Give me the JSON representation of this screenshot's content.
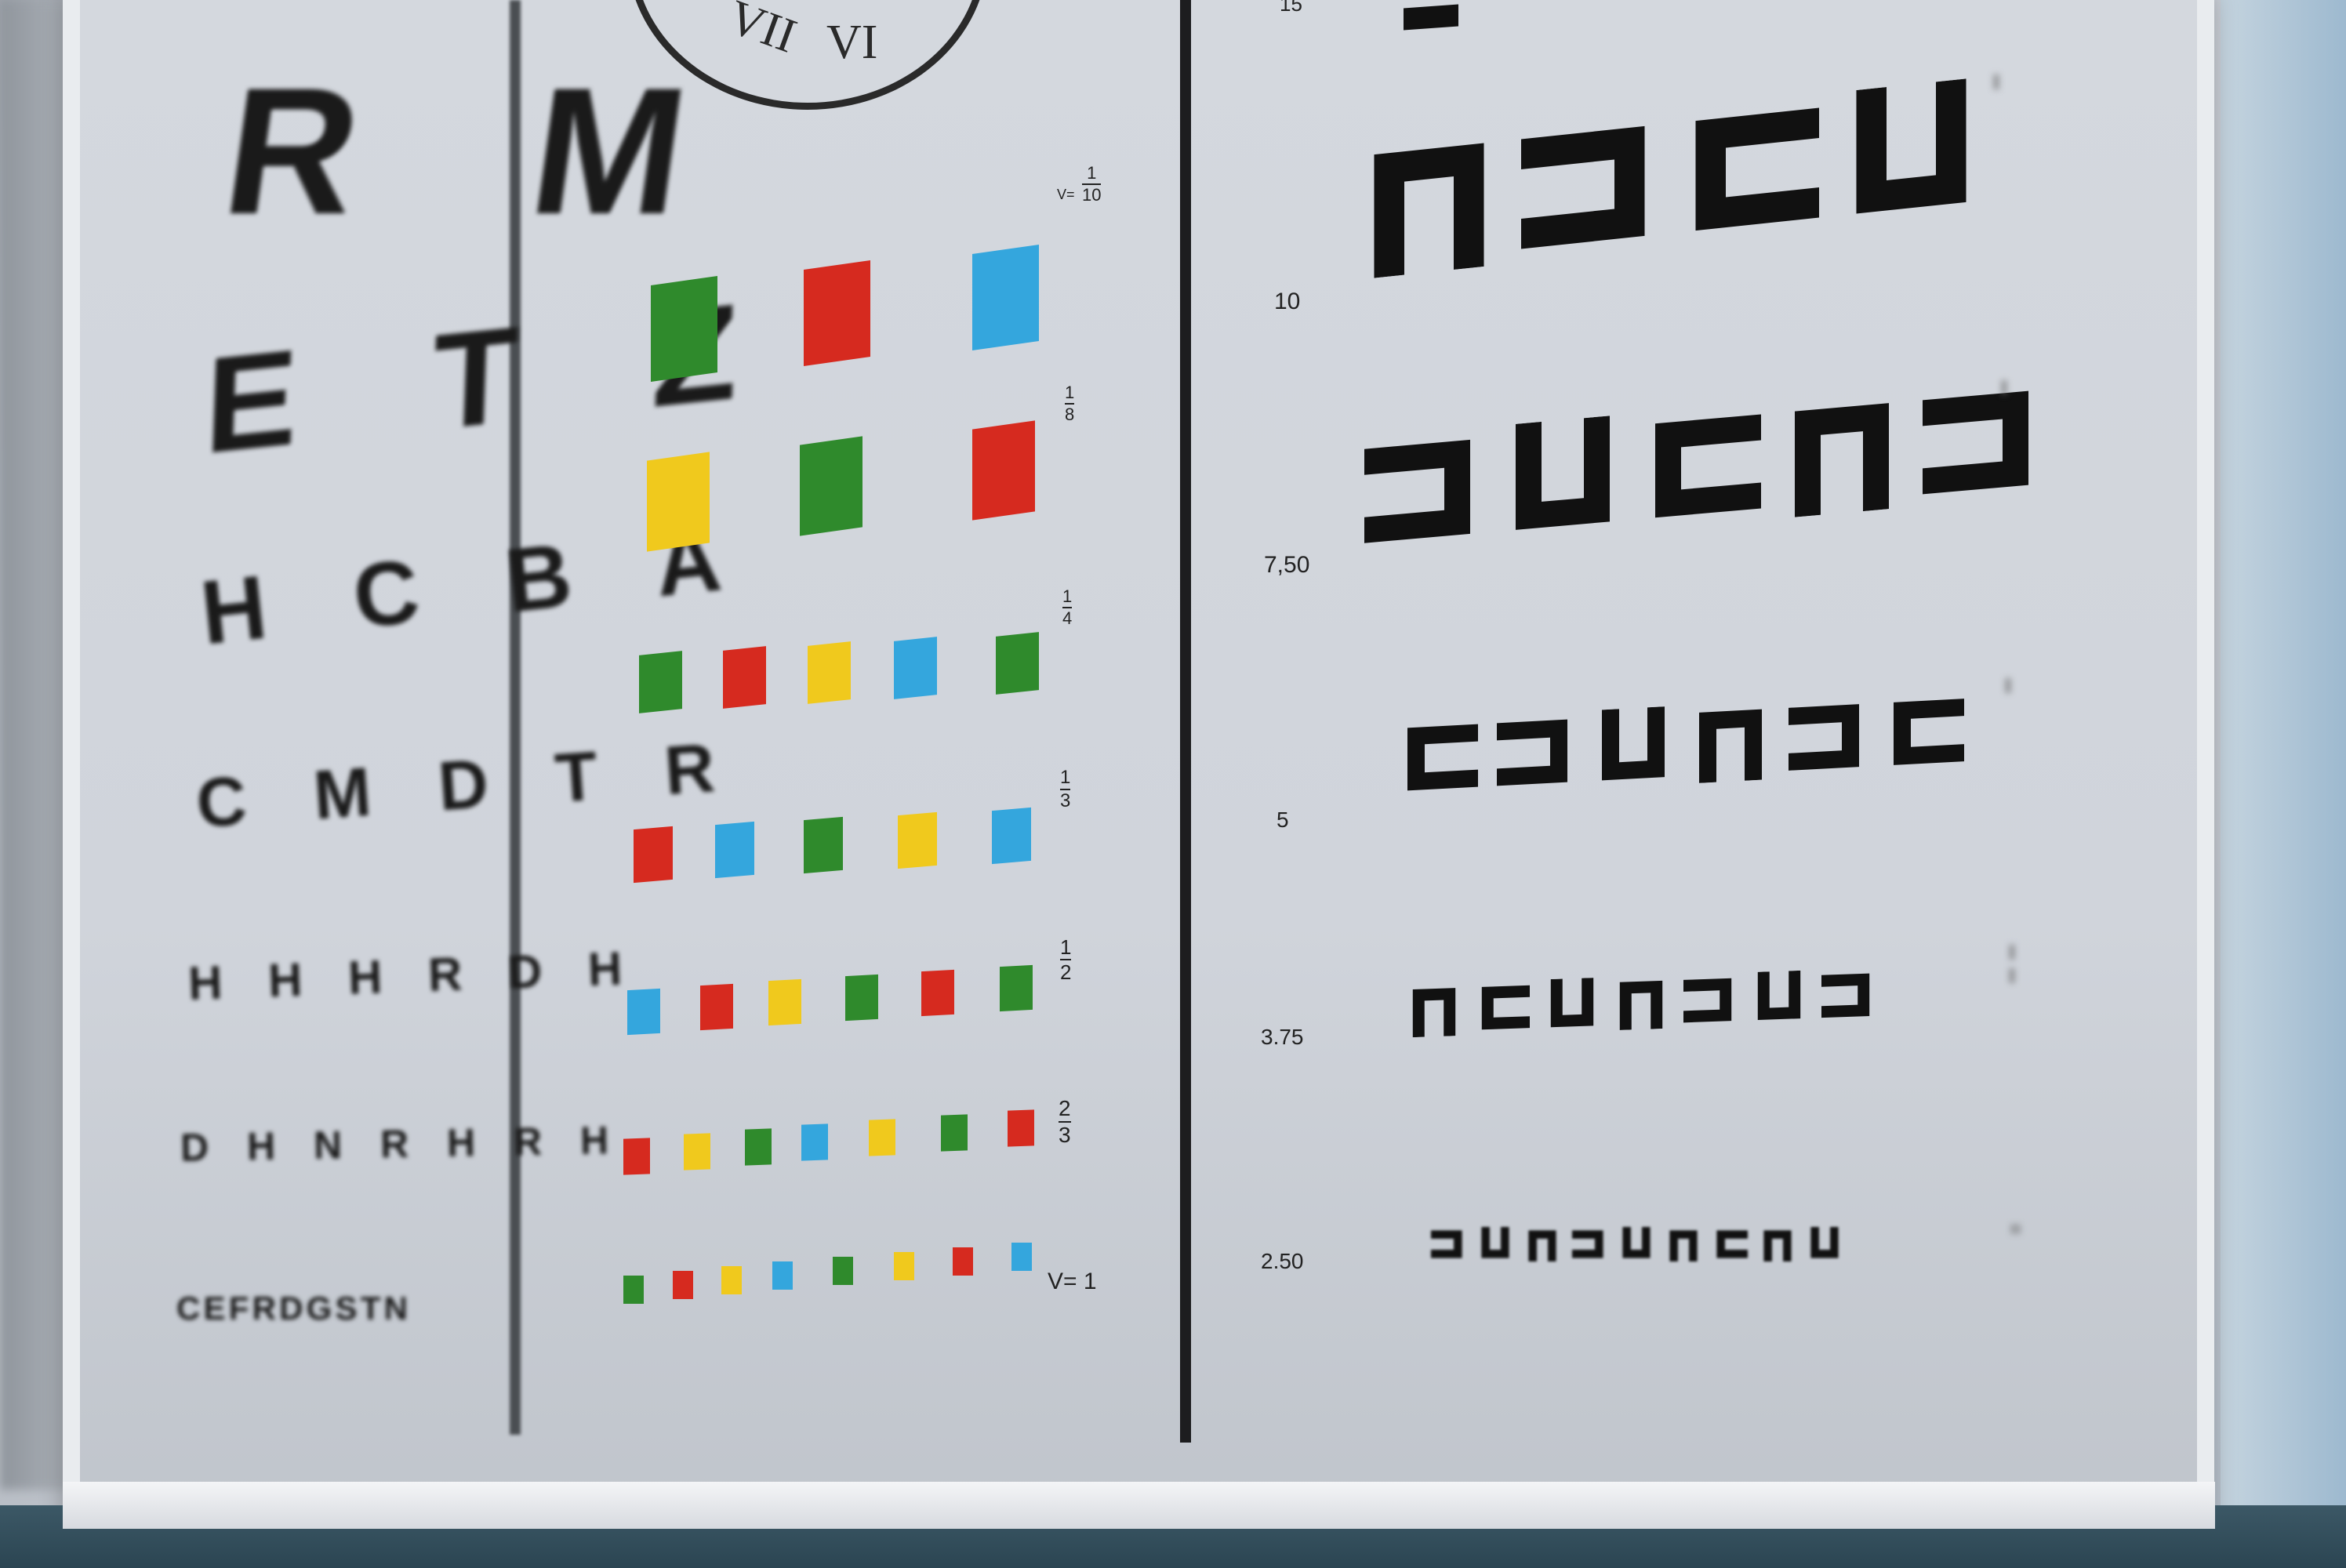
{
  "chart": {
    "left_column": {
      "rows": [
        {
          "letters": "R M"
        },
        {
          "letters": "E T Z"
        },
        {
          "letters": "H C B A"
        },
        {
          "letters": "C M D T R"
        },
        {
          "letters": "H H H R D H"
        },
        {
          "letters": "D H N R H R H"
        },
        {
          "letters": "CEFRDGSTN"
        }
      ]
    },
    "clock": {
      "numerals": [
        "VI",
        "VII"
      ]
    },
    "color_column": {
      "v_prefix": "V=",
      "fractions": [
        {
          "num": "1",
          "den": "10"
        },
        {
          "num": "1",
          "den": "8"
        },
        {
          "num": "1",
          "den": "4"
        },
        {
          "num": "1",
          "den": "3"
        },
        {
          "num": "1",
          "den": "2"
        },
        {
          "num": "2",
          "den": "3"
        }
      ],
      "last_label": "V= 1",
      "rows": [
        {
          "colors": [
            "green",
            "red",
            "blue"
          ]
        },
        {
          "colors": [
            "yellow",
            "green",
            "red"
          ]
        },
        {
          "colors": [
            "green",
            "red",
            "yellow",
            "blue",
            "green"
          ]
        },
        {
          "colors": [
            "red",
            "blue",
            "green",
            "yellow",
            "blue"
          ]
        },
        {
          "colors": [
            "blue",
            "red",
            "yellow",
            "green",
            "red",
            "green"
          ]
        },
        {
          "colors": [
            "red",
            "yellow",
            "green",
            "blue",
            "yellow",
            "green",
            "red"
          ]
        },
        {
          "colors": [
            "green",
            "red",
            "yellow",
            "blue",
            "green",
            "yellow",
            "red",
            "blue"
          ]
        }
      ],
      "palette": {
        "green": "#2f8a2c",
        "red": "#d62a1f",
        "blue": "#34a6dd",
        "yellow": "#f0c91d"
      }
    },
    "right_column": {
      "acuity_labels": [
        "15",
        "10",
        "7,50",
        "5",
        "3.75",
        "2.50"
      ],
      "rows": [
        {
          "symbols": [
            "partial"
          ]
        },
        {
          "symbols": [
            "n",
            "reverse-c",
            "c",
            "u"
          ]
        },
        {
          "symbols": [
            "reverse-c",
            "u",
            "c",
            "n",
            "reverse-c"
          ]
        },
        {
          "symbols": [
            "c",
            "reverse-c",
            "u",
            "n",
            "reverse-c",
            "c"
          ]
        },
        {
          "symbols": [
            "n",
            "c",
            "u",
            "n",
            "reverse-c",
            "u",
            "reverse-c"
          ]
        },
        {
          "symbols": [
            "reverse-c",
            "u",
            "n",
            "reverse-c",
            "u",
            "n",
            "c",
            "n",
            "u"
          ]
        }
      ]
    }
  }
}
